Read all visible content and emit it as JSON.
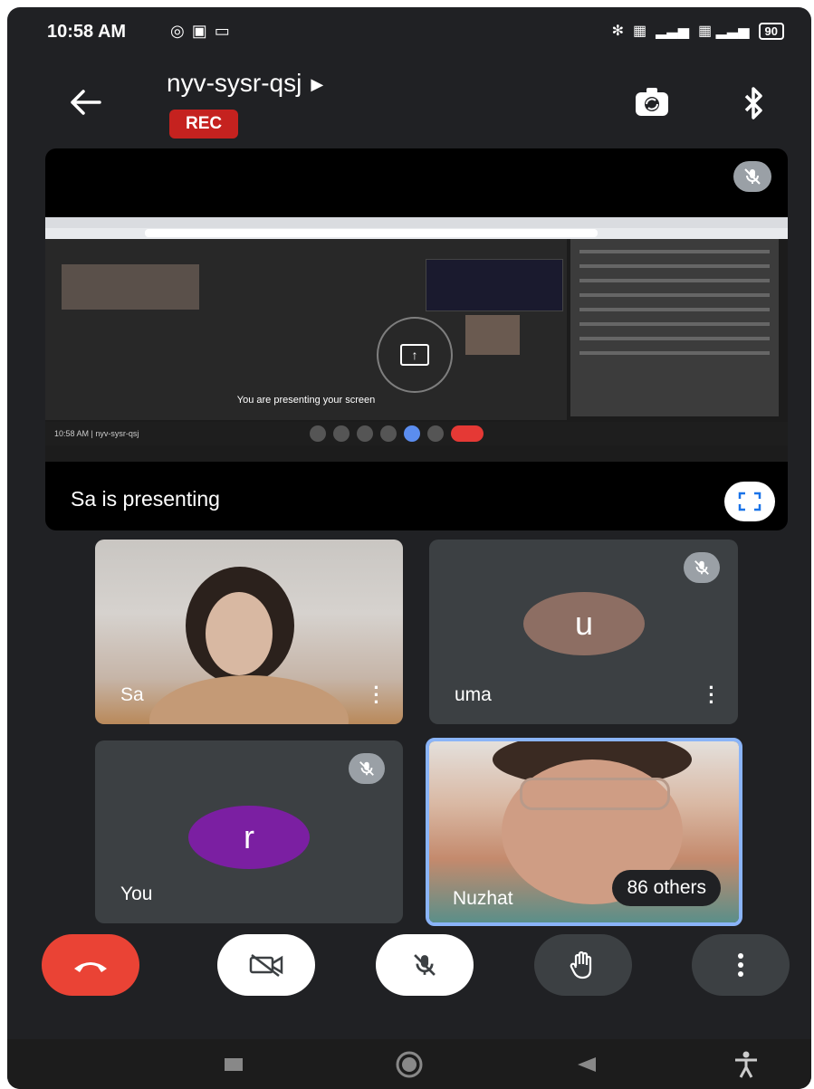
{
  "status_bar": {
    "time": "10:58 AM",
    "left_icons": [
      "whatsapp-icon",
      "notification-icon",
      "cast-icon"
    ],
    "right_icons": [
      "bluetooth-icon",
      "volte-icon",
      "signal-icon",
      "signal-4g-icon"
    ],
    "battery": "90"
  },
  "header": {
    "meeting_code": "nyv-sysr-qsj",
    "rec_label": "REC",
    "icons": [
      "back-arrow-icon",
      "switch-camera-icon",
      "bluetooth-audio-icon"
    ]
  },
  "presentation": {
    "presenter_label": "Sa is presenting",
    "shared_screen_text": "You are presenting your screen",
    "shared_screen_bottom": "10:58 AM  |  nyv-sysr-qsj",
    "presenter_muted": true
  },
  "participants": [
    {
      "name": "Sa",
      "type": "video",
      "muted": false
    },
    {
      "name": "uma",
      "type": "avatar",
      "initial": "u",
      "avatar_color": "#8d6e63",
      "muted": true
    },
    {
      "name": "You",
      "type": "avatar",
      "initial": "r",
      "avatar_color": "#7b1fa2",
      "muted": true
    },
    {
      "name": "Nuzhat",
      "type": "video",
      "active_speaker": true,
      "highlight_color": "#8ab4f8"
    }
  ],
  "others_chip": "86 others",
  "controls": {
    "icons": [
      "end-call-icon",
      "camera-off-icon",
      "mic-off-icon",
      "raise-hand-icon",
      "more-options-icon"
    ],
    "end_call_color": "#ea4335"
  },
  "nav_bar": {
    "icons": [
      "recents-icon",
      "home-icon",
      "back-icon",
      "accessibility-icon"
    ]
  }
}
